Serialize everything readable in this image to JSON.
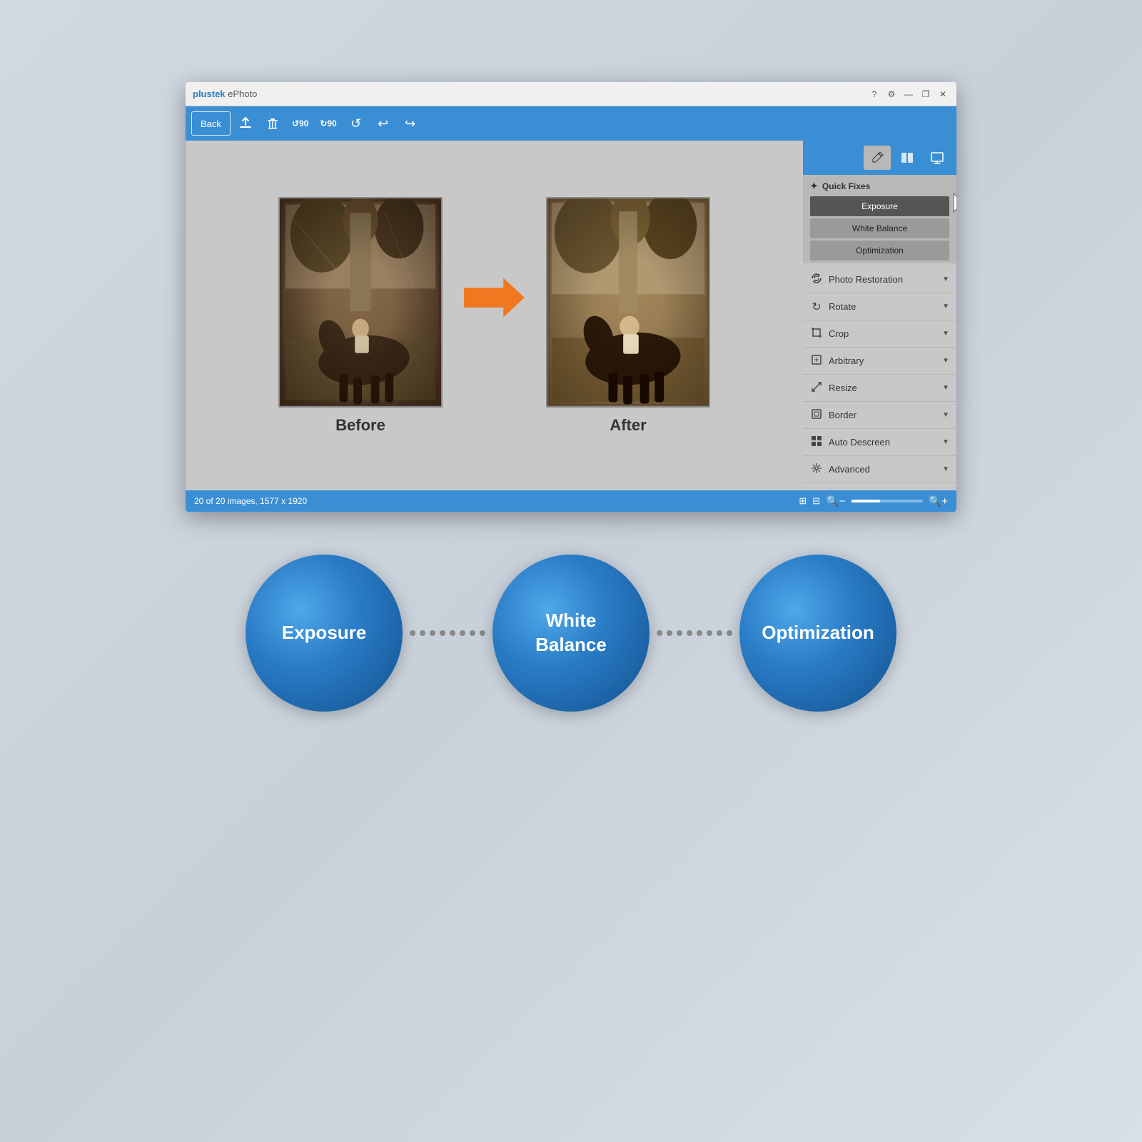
{
  "app": {
    "title_plus": "plus",
    "title_tek": "tek",
    "title_ephoto": " ePhoto"
  },
  "titlebar": {
    "help_icon": "?",
    "settings_icon": "⚙",
    "minimize_icon": "—",
    "maximize_icon": "❐",
    "close_icon": "✕"
  },
  "toolbar": {
    "back_label": "Back",
    "rotate_ccw": "↺90",
    "rotate_cw": "↻90",
    "refresh": "↺",
    "undo": "↩",
    "redo": "↪"
  },
  "canvas": {
    "before_label": "Before",
    "after_label": "After"
  },
  "status_bar": {
    "info": "20 of 20 images, 1577 x 1920",
    "zoom_minus": "🔍",
    "zoom_plus": "🔍"
  },
  "quick_fixes": {
    "header": "Quick Fixes",
    "exposure_label": "Exposure",
    "white_balance_label": "White Balance",
    "optimization_label": "Optimization"
  },
  "panel_items": [
    {
      "icon": "🔧",
      "label": "Photo Restoration"
    },
    {
      "icon": "↻",
      "label": "Rotate"
    },
    {
      "icon": "✂",
      "label": "Crop"
    },
    {
      "icon": "◱",
      "label": "Arbitrary"
    },
    {
      "icon": "⊡",
      "label": "Resize"
    },
    {
      "icon": "▭",
      "label": "Border"
    },
    {
      "icon": "⊞",
      "label": "Auto Descreen"
    },
    {
      "icon": "≋",
      "label": "Advanced"
    }
  ],
  "bottom_circles": [
    {
      "label": "Exposure"
    },
    {
      "label": "White\nBalance"
    },
    {
      "label": "Optimization"
    }
  ],
  "colors": {
    "blue_accent": "#3a8fd4",
    "orange_arrow": "#f07820",
    "circle_blue": "#2a7cc7",
    "panel_bg": "#b8b8b8"
  }
}
